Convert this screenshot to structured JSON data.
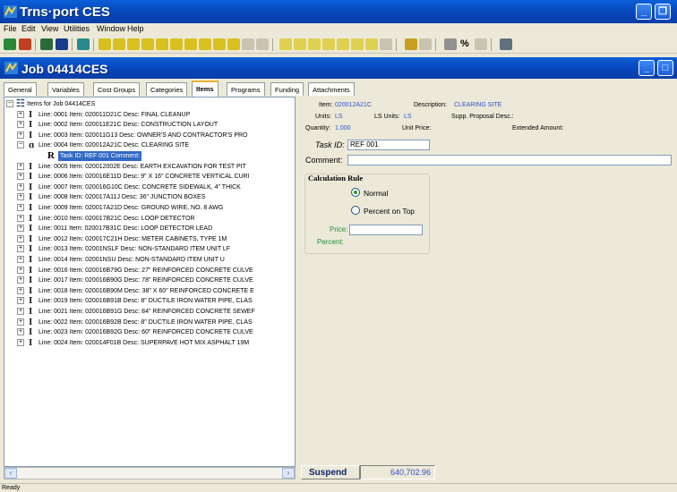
{
  "app": {
    "title": "Trns·port CES"
  },
  "menu": [
    "File",
    "Edit",
    "View",
    "Utilities",
    "Window",
    "Help"
  ],
  "job_window": {
    "title": "Job 04414CES"
  },
  "tabs": [
    "General",
    "Variables",
    "Cost Groups",
    "Categories",
    "Items",
    "Programs",
    "Funding",
    "Attachments"
  ],
  "active_tab": "Items",
  "tree": {
    "root_label": "Items for Job 04414CES",
    "rows": [
      "Line: 0001  Item: 020011D21C  Desc: FINAL CLEANUP",
      "Line: 0002  Item: 020011E21C  Desc: CONSTRUCTION LAYOUT",
      "Line: 0003  Item: 020011G13  Desc: OWNER'S AND CONTRACTOR'S PRO",
      "Line: 0004  Item: 020012A21C  Desc: CLEARING SITE",
      "Task ID: REF 001  Comment:",
      "Line: 0005  Item: 020012002E  Desc: EARTH EXCAVATION FOR TEST PIT",
      "Line: 0006  Item: 020016E11D  Desc: 9\" X 16\" CONCRETE VERTICAL CURI",
      "Line: 0007  Item: 020016G10C  Desc: CONCRETE SIDEWALK, 4\" THICK",
      "Line: 0008  Item: 020017A11J  Desc: 36\" JUNCTION BOXES",
      "Line: 0009  Item: 020017A21D  Desc: GROUND WIRE, NO. 8 AWG",
      "Line: 0010  Item: 020017B21C  Desc: LOOP DETECTOR",
      "Line: 0011  Item: 020017B31C  Desc: LOOP DETECTOR LEAD",
      "Line: 0012  Item: 020017C21H  Desc: METER CABINETS, TYPE 1M",
      "Line: 0013  Item: 02001NSLF  Desc: NON-STANDARD ITEM UNIT LF",
      "Line: 0014  Item: 02001NSU  Desc: NON-STANDARD ITEM UNIT U",
      "Line: 0016  Item: 020016B79G  Desc: 27\" REINFORCED CONCRETE CULVE",
      "Line: 0017  Item: 020016B90G  Desc: 78\" REINFORCED CONCRETE CULVE",
      "Line: 0018  Item: 020016B90M  Desc: 38\" X 60\" REINFORCED CONCRETE E",
      "Line: 0019  Item: 020016B91B  Desc: 8\" DUCTILE IRON WATER PIPE, CLAS",
      "Line: 0021  Item: 020016B91G  Desc: 84\" REINFORCED CONCRETE SEWEF",
      "Line: 0022  Item: 020016B92B  Desc: 8\" DUCTILE IRON WATER PIPE, CLAS",
      "Line: 0023  Item: 020016B92G  Desc: 60\" REINFORCED CONCRETE CULVE",
      "Line: 0024  Item: 020014F01B  Desc: SUPERPAVE HOT MIX ASPHALT 19M"
    ]
  },
  "detail": {
    "item_label": "Item:",
    "item_value": "020012A21C",
    "description_label": "Description:",
    "description_value": "CLEARING SITE",
    "units_label": "Units:",
    "units_value": "LS",
    "ls_units_label": "LS Units:",
    "ls_units_value": "LS",
    "supp_label": "Supp. Proposal Desc.:",
    "quantity_label": "Quantity:",
    "quantity_value": "1.000",
    "unit_price_label": "Unit Price:",
    "extended_label": "Extended Amount:",
    "task_id_label": "Task ID:",
    "task_id_value": "REF 001",
    "comment_label": "Comment:",
    "comment_value": "",
    "calc_rule_label": "Calculation Rule",
    "radio_normal": "Normal",
    "radio_percent": "Percent on Top",
    "price_label": "Price:",
    "price_value": "",
    "percent_label": "Percent:"
  },
  "bottom": {
    "suspend_label": "Suspend",
    "total_value": "640,702.96"
  },
  "status": {
    "text": "Ready"
  },
  "colors": {
    "titlebar": "#0a5fd8",
    "selection": "#316ac5",
    "link_blue": "#3050d0"
  }
}
